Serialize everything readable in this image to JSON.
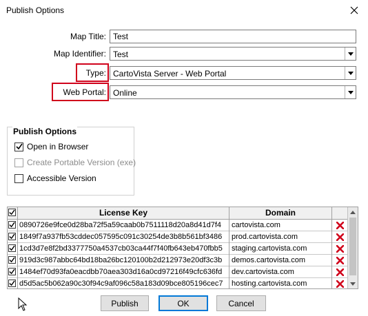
{
  "window": {
    "title": "Publish Options"
  },
  "form": {
    "map_title_label": "Map Title:",
    "map_title_value": "Test",
    "map_identifier_label": "Map Identifier:",
    "map_identifier_value": "Test",
    "type_label": "Type:",
    "type_value": "CartoVista Server - Web Portal",
    "web_portal_label": "Web Portal:",
    "web_portal_value": "Online"
  },
  "publish_options": {
    "title": "Publish Options",
    "items": [
      {
        "label": "Open in Browser",
        "checked": true,
        "enabled": true
      },
      {
        "label": "Create Portable Version (exe)",
        "checked": false,
        "enabled": false
      },
      {
        "label": "Accessible Version",
        "checked": false,
        "enabled": true
      }
    ]
  },
  "license_table": {
    "headers": {
      "key": "License Key",
      "domain": "Domain"
    },
    "rows": [
      {
        "checked": true,
        "key": "0890726e9fce0d28ba72f5a59caab0b7511118d20a8d41d7f4",
        "domain": "cartovista.com"
      },
      {
        "checked": true,
        "key": "1849f7a937fb53cddec057595c091c30254de3b8b561bf3486",
        "domain": "prod.cartovista.com"
      },
      {
        "checked": true,
        "key": "1cd3d7e8f2bd3377750a4537cb03ca44f7f40fb643eb470fbb5",
        "domain": "staging.cartovista.com"
      },
      {
        "checked": true,
        "key": "919d3c987abbc64bd18ba26bc120100b2d212973e20df3c3b",
        "domain": "demos.cartovista.com"
      },
      {
        "checked": true,
        "key": "1484ef70d93fa0eacdbb70aea303d16a0cd97216f49cfc636fd",
        "domain": "dev.cartovista.com"
      },
      {
        "checked": true,
        "key": "d5d5ac5b062a90c30f94c9af096c58a183d09bce805196cec7",
        "domain": "hosting.cartovista.com"
      }
    ]
  },
  "buttons": {
    "publish": "Publish",
    "ok": "OK",
    "cancel": "Cancel"
  },
  "colors": {
    "highlight_box": "#d0021b",
    "delete_icon": "#d0021b",
    "default_button_border": "#0078d7"
  }
}
